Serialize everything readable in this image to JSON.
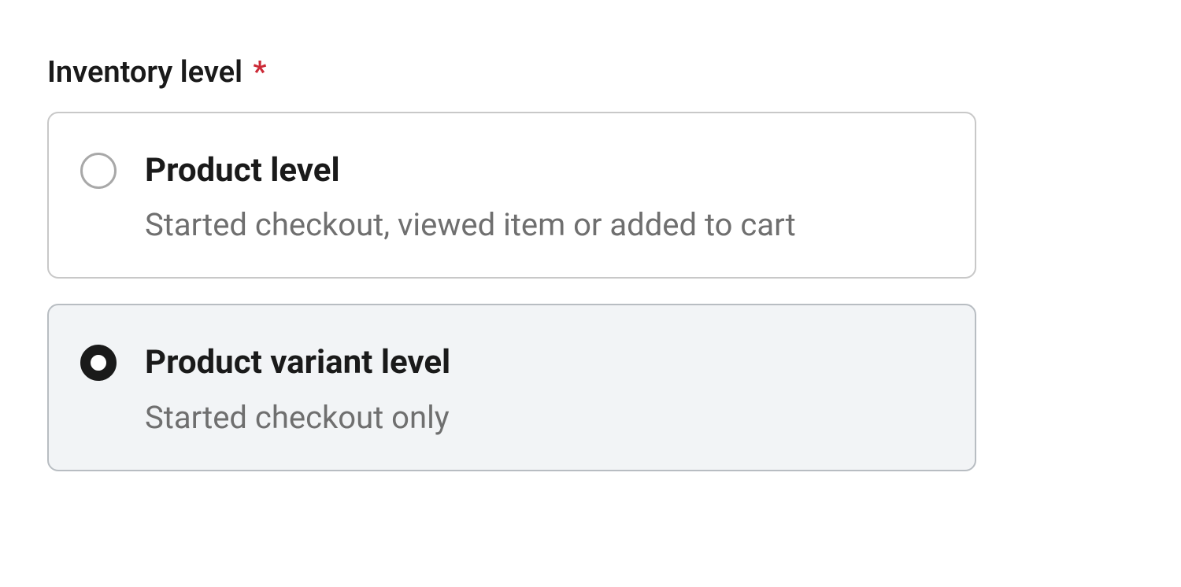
{
  "inventory_level": {
    "label": "Inventory level",
    "required_marker": "*",
    "options": [
      {
        "title": "Product level",
        "description": "Started checkout, viewed item or added to cart",
        "selected": false
      },
      {
        "title": "Product variant level",
        "description": "Started checkout only",
        "selected": true
      }
    ]
  }
}
